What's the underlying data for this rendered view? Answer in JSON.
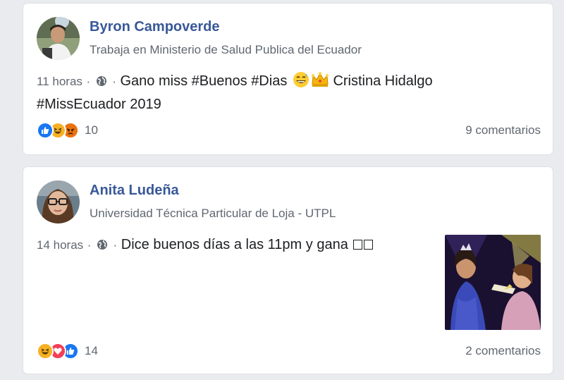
{
  "posts": [
    {
      "author": "Byron Campoverde",
      "subtitle": "Trabaja en Ministerio de Salud Publica del Ecuador",
      "time": "11 horas",
      "separator": "·",
      "text_before": "Gano miss ",
      "hashtag1": "#Buenos",
      "hashtag2": "#Dias",
      "text_after": " Cristina Hidalgo",
      "line2": "#MissEcuador 2019",
      "reaction_count": "10",
      "comments": "9 comentarios",
      "reactions": [
        "like",
        "haha",
        "angry"
      ]
    },
    {
      "author": "Anita Ludeña",
      "subtitle": "Universidad Técnica Particular de Loja - UTPL",
      "time": "14 horas",
      "separator": "·",
      "text": "Dice buenos días a las 11pm y gana",
      "reaction_count": "14",
      "comments": "2 comentarios",
      "reactions": [
        "haha",
        "love",
        "like"
      ],
      "has_photo": true
    }
  ],
  "colors": {
    "link": "#385898",
    "meta": "#606770",
    "like": "#1877f2",
    "love": "#f33e58",
    "haha": "#f7b125",
    "angry": "#e9710f"
  },
  "icons": [
    "globe-icon",
    "grinning-sweat-emoji",
    "crown-emoji"
  ]
}
